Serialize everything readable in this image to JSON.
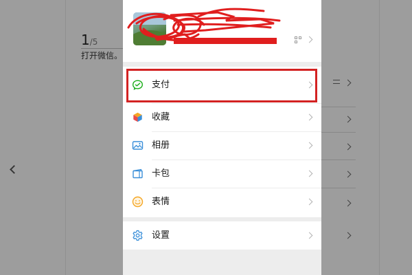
{
  "background_page": {
    "step_number": "1",
    "step_total": "/5",
    "caption": "打开微信。"
  },
  "profile": {
    "avatar": "user-avatar-photo",
    "name_redacted": true,
    "icons": [
      "qr-code-icon",
      "chevron-right-icon"
    ]
  },
  "menu": {
    "items": [
      {
        "label": "支付",
        "icon": "wechat-pay-icon",
        "color": "#1aad19"
      },
      {
        "label": "收藏",
        "icon": "favorites-cube-icon",
        "color": "#e8a33c"
      },
      {
        "label": "相册",
        "icon": "album-icon",
        "color": "#3a8fd9"
      },
      {
        "label": "卡包",
        "icon": "card-wallet-icon",
        "color": "#3a8fd9"
      },
      {
        "label": "表情",
        "icon": "sticker-smile-icon",
        "color": "#f5a623"
      }
    ],
    "settings": {
      "label": "设置",
      "icon": "gear-icon",
      "color": "#3a8fd9"
    }
  },
  "highlight": {
    "target": "支付",
    "color": "#d32222"
  },
  "colors": {
    "screen_bg": "#ededed",
    "card_bg": "#ffffff",
    "redaction": "#e01e1e"
  }
}
